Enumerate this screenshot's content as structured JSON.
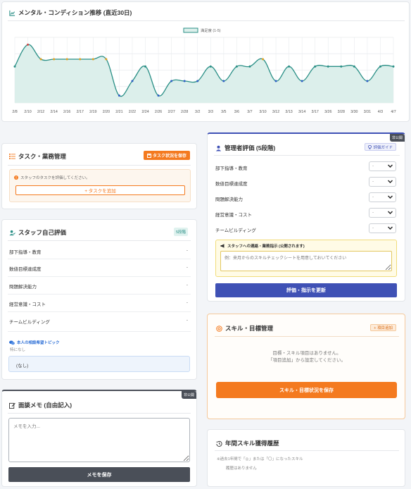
{
  "trend": {
    "title": "メンタル・コンディション推移 (直近30日)",
    "legend": "満足度 (1-5)"
  },
  "chart_data": {
    "type": "line",
    "x": [
      "2/8",
      "2/10",
      "2/12",
      "2/14",
      "2/16",
      "2/17",
      "2/19",
      "2/20",
      "2/21",
      "2/22",
      "2/24",
      "2/26",
      "2/27",
      "2/28",
      "3/2",
      "3/3",
      "3/5",
      "3/6",
      "3/7",
      "3/10",
      "3/12",
      "3/13",
      "3/14",
      "3/17",
      "3/26",
      "3/28",
      "3/30",
      "3/31",
      "4/3",
      "4/7"
    ],
    "series": [
      {
        "name": "満足度 (1-5)",
        "values": [
          3.5,
          5.0,
          4.0,
          4.0,
          4.0,
          4.0,
          4.0,
          4.0,
          1.5,
          2.5,
          3.5,
          1.5,
          2.5,
          2.5,
          2.5,
          3.5,
          2.5,
          3.5,
          3.5,
          4.0,
          2.5,
          3.5,
          2.5,
          3.5,
          3.5,
          3.5,
          3.5,
          2.5,
          3.5,
          3.5
        ]
      }
    ],
    "ylim": [
      1,
      5.5
    ],
    "grid": true,
    "legend_position": "top-center",
    "colors": {
      "line": "#2a8f86",
      "fill": "#dcefeb",
      "grid": "#e8ebee"
    }
  },
  "tasks": {
    "title": "タスク・業務管理",
    "save_button": "タスク状況を保存",
    "info": "スタッフのタスクを評価してください。",
    "add_button": "+ タスクを追加"
  },
  "self_eval": {
    "title": "スタッフ自己評価",
    "badge": "5段階",
    "rows": [
      {
        "label": "部下指導・教育",
        "value": "-"
      },
      {
        "label": "数値目標達成度",
        "value": "-"
      },
      {
        "label": "問題解決能力",
        "value": "-"
      },
      {
        "label": "経営意識・コスト",
        "value": "-"
      },
      {
        "label": "チームビルディング",
        "value": "-"
      }
    ],
    "topic_title": "本人の相談希望トピック",
    "topic_sub": "特になし",
    "topic_value": "(なし)"
  },
  "memo": {
    "corner": "非公開",
    "title": "面談メモ (自由記入)",
    "placeholder": "メモを入力...",
    "save_button": "メモを保存"
  },
  "manager_eval": {
    "corner": "非公開",
    "title": "管理者評価 (5段階)",
    "guide": "評価ガイド",
    "rows": [
      {
        "label": "部下指導・教育",
        "value": "-"
      },
      {
        "label": "数値目標達成度",
        "value": "-"
      },
      {
        "label": "問題解決能力",
        "value": "-"
      },
      {
        "label": "経営意識・コスト",
        "value": "-"
      },
      {
        "label": "チームビルディング",
        "value": "-"
      }
    ],
    "notice_title": "スタッフへの連絡・業務指示 (公開されます)",
    "notice_placeholder": "例：来月からのスキルチェックシートを用意しておいてください",
    "update_button": "評価・指示を更新"
  },
  "skills": {
    "title": "スキル・目標管理",
    "add_button": "+ 項目追加",
    "empty_line1": "目標・スキル項目はありません。",
    "empty_line2": "「項目追加」から設定してください。",
    "save_button": "スキル・目標状況を保存"
  },
  "history": {
    "title": "年間スキル獲得履歴",
    "note": "※過去1年間で「◎」または「〇」になったスキル",
    "empty": "履歴はありません"
  }
}
